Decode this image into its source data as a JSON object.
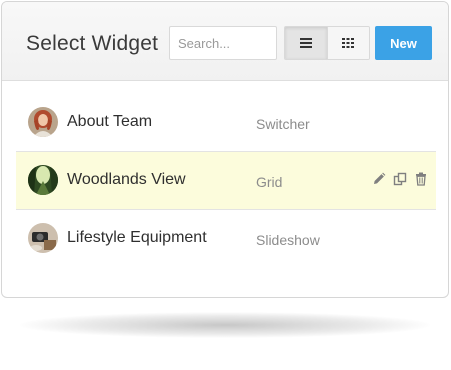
{
  "header": {
    "title": "Select Widget",
    "search_placeholder": "Search...",
    "view_toggle": [
      {
        "name": "list-view",
        "icon": "list-icon",
        "active": true
      },
      {
        "name": "grid-view",
        "icon": "grid-icon",
        "active": false
      }
    ],
    "new_label": "New"
  },
  "widgets": [
    {
      "name": "About Team",
      "type": "Switcher",
      "highlighted": false,
      "avatar": "portrait"
    },
    {
      "name": "Woodlands View",
      "type": "Grid",
      "highlighted": true,
      "avatar": "forest"
    },
    {
      "name": "Lifestyle Equipment",
      "type": "Slideshow",
      "highlighted": false,
      "avatar": "camera"
    }
  ],
  "row_actions": [
    "edit-icon",
    "duplicate-icon",
    "delete-icon"
  ],
  "colors": {
    "accent": "#3ba2e6",
    "highlight_row": "#fcfcdc",
    "type_text": "#8c8c8c"
  }
}
